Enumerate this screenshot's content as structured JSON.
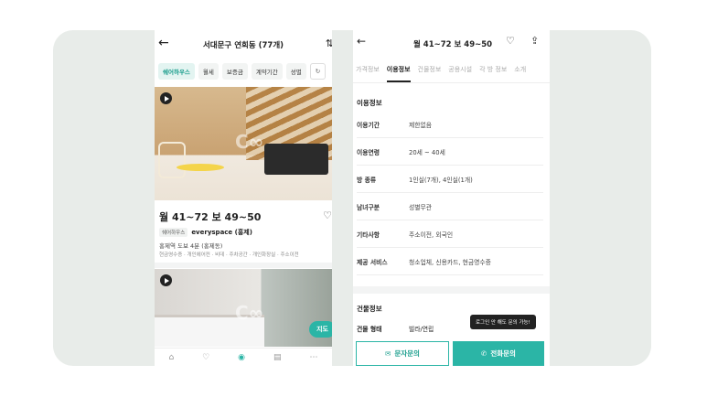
{
  "left": {
    "title": "서대문구 연희동 (77개)",
    "chips": [
      "쉐어하우스",
      "월세",
      "보증금",
      "계약기간",
      "성별"
    ],
    "listing1": {
      "price": "월 41~72  보 49~50",
      "tag": "쉐어하우스",
      "agency": "everyspace (홍제)",
      "station": "홍제역 도보 4분 (홍제동)",
      "options": "현금영수증 · 개인에어컨 · 비데 · 주차공간 · 개인화장실 · 주소이전"
    },
    "map_button": "지도"
  },
  "right": {
    "title": "월 41~72  보 49~50",
    "tabs": [
      "가격정보",
      "이용정보",
      "건물정보",
      "공용시설",
      "각 방 정보",
      "소개"
    ],
    "section1": "이용정보",
    "rows": [
      {
        "k": "이용기간",
        "v": "제한없음"
      },
      {
        "k": "이용연령",
        "v": "20세 ~ 40세"
      },
      {
        "k": "방 종류",
        "v": "1인실(7개), 4인실(1개)"
      },
      {
        "k": "남녀구분",
        "v": "성별무관"
      },
      {
        "k": "기타사항",
        "v": "주소이전, 외국인"
      },
      {
        "k": "제공 서비스",
        "v": "청소업체, 신용카드, 현금영수증"
      }
    ],
    "section2": "건물정보",
    "row2": {
      "k": "건물 형태",
      "v": "빌라/연립"
    },
    "tooltip": "로그인 안 해도 문의 가능!",
    "msg_button": "문자문의",
    "call_button": "전화문의"
  }
}
